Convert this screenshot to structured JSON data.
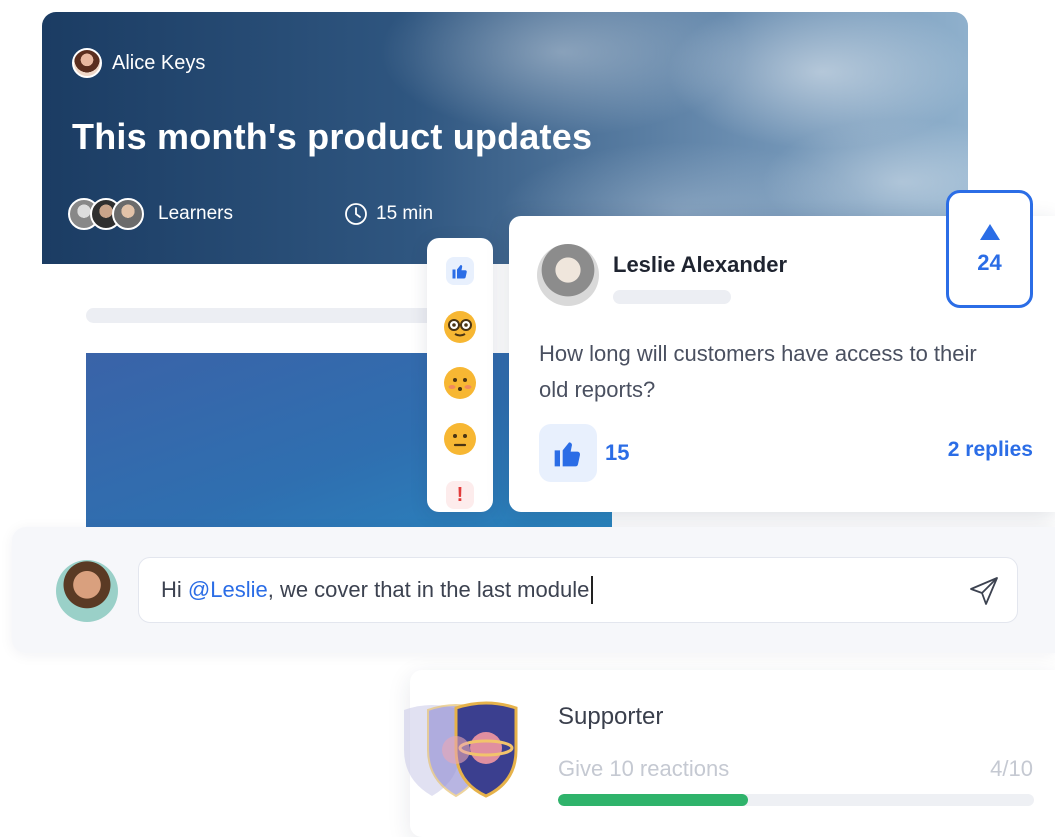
{
  "hero": {
    "author": "Alice Keys",
    "title": "This month's product updates",
    "audience": "Learners",
    "duration": "15 min"
  },
  "reactions": {
    "icons": [
      "thumbs-up-icon",
      "nerd-glasses-emoji",
      "blushing-emoji",
      "neutral-face-emoji",
      "exclamation-icon"
    ]
  },
  "comment": {
    "author": "Leslie Alexander",
    "text": "How long will customers have access to their old reports?",
    "likes": "15",
    "replies": "2 replies",
    "upvotes": "24"
  },
  "composer": {
    "prefix": "Hi ",
    "mention": "@Leslie",
    "suffix": ", we cover that in the last module"
  },
  "achievement": {
    "title": "Supporter",
    "description": "Give 10 reactions",
    "progress_label": "4/10",
    "progress_fraction": 0.4
  },
  "colors": {
    "accent": "#2b6de6",
    "progress": "#2fb36b"
  }
}
